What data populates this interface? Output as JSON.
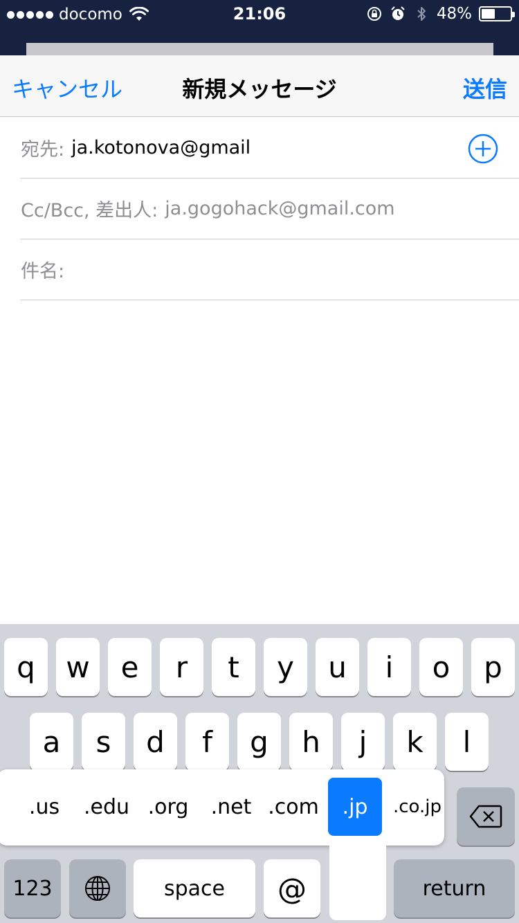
{
  "status_bar": {
    "carrier": "docomo",
    "time": "21:06",
    "battery_percent": "48%",
    "battery_level": 0.48
  },
  "nav": {
    "cancel": "キャンセル",
    "title": "新規メッセージ",
    "send": "送信"
  },
  "fields": {
    "to_label": "宛先:",
    "to_value": "ja.kotonova@gmail",
    "ccbcc_label": "Cc/Bcc, 差出人:",
    "ccbcc_value": "ja.gogohack@gmail.com",
    "subject_label": "件名:"
  },
  "keyboard": {
    "row1": [
      "q",
      "w",
      "e",
      "r",
      "t",
      "y",
      "u",
      "i",
      "o",
      "p"
    ],
    "row2": [
      "a",
      "s",
      "d",
      "f",
      "g",
      "h",
      "j",
      "k",
      "l"
    ],
    "numbers": "123",
    "space": "space",
    "at": "@",
    "return": "return"
  },
  "domain_popup": {
    "options": [
      ".us",
      ".edu",
      ".org",
      ".net",
      ".com",
      ".jp",
      ".co.jp"
    ],
    "selected": ".jp"
  },
  "icons": {
    "wifi": "wifi-icon",
    "rotation_lock": "rotation-lock-icon",
    "alarm": "alarm-icon",
    "bluetooth": "bluetooth-icon",
    "add_contact": "plus-circle-icon",
    "globe": "globe-icon",
    "delete": "delete-backspace-icon"
  },
  "colors": {
    "accent": "#0a7aff",
    "status_bar_bg": "#16223f"
  }
}
